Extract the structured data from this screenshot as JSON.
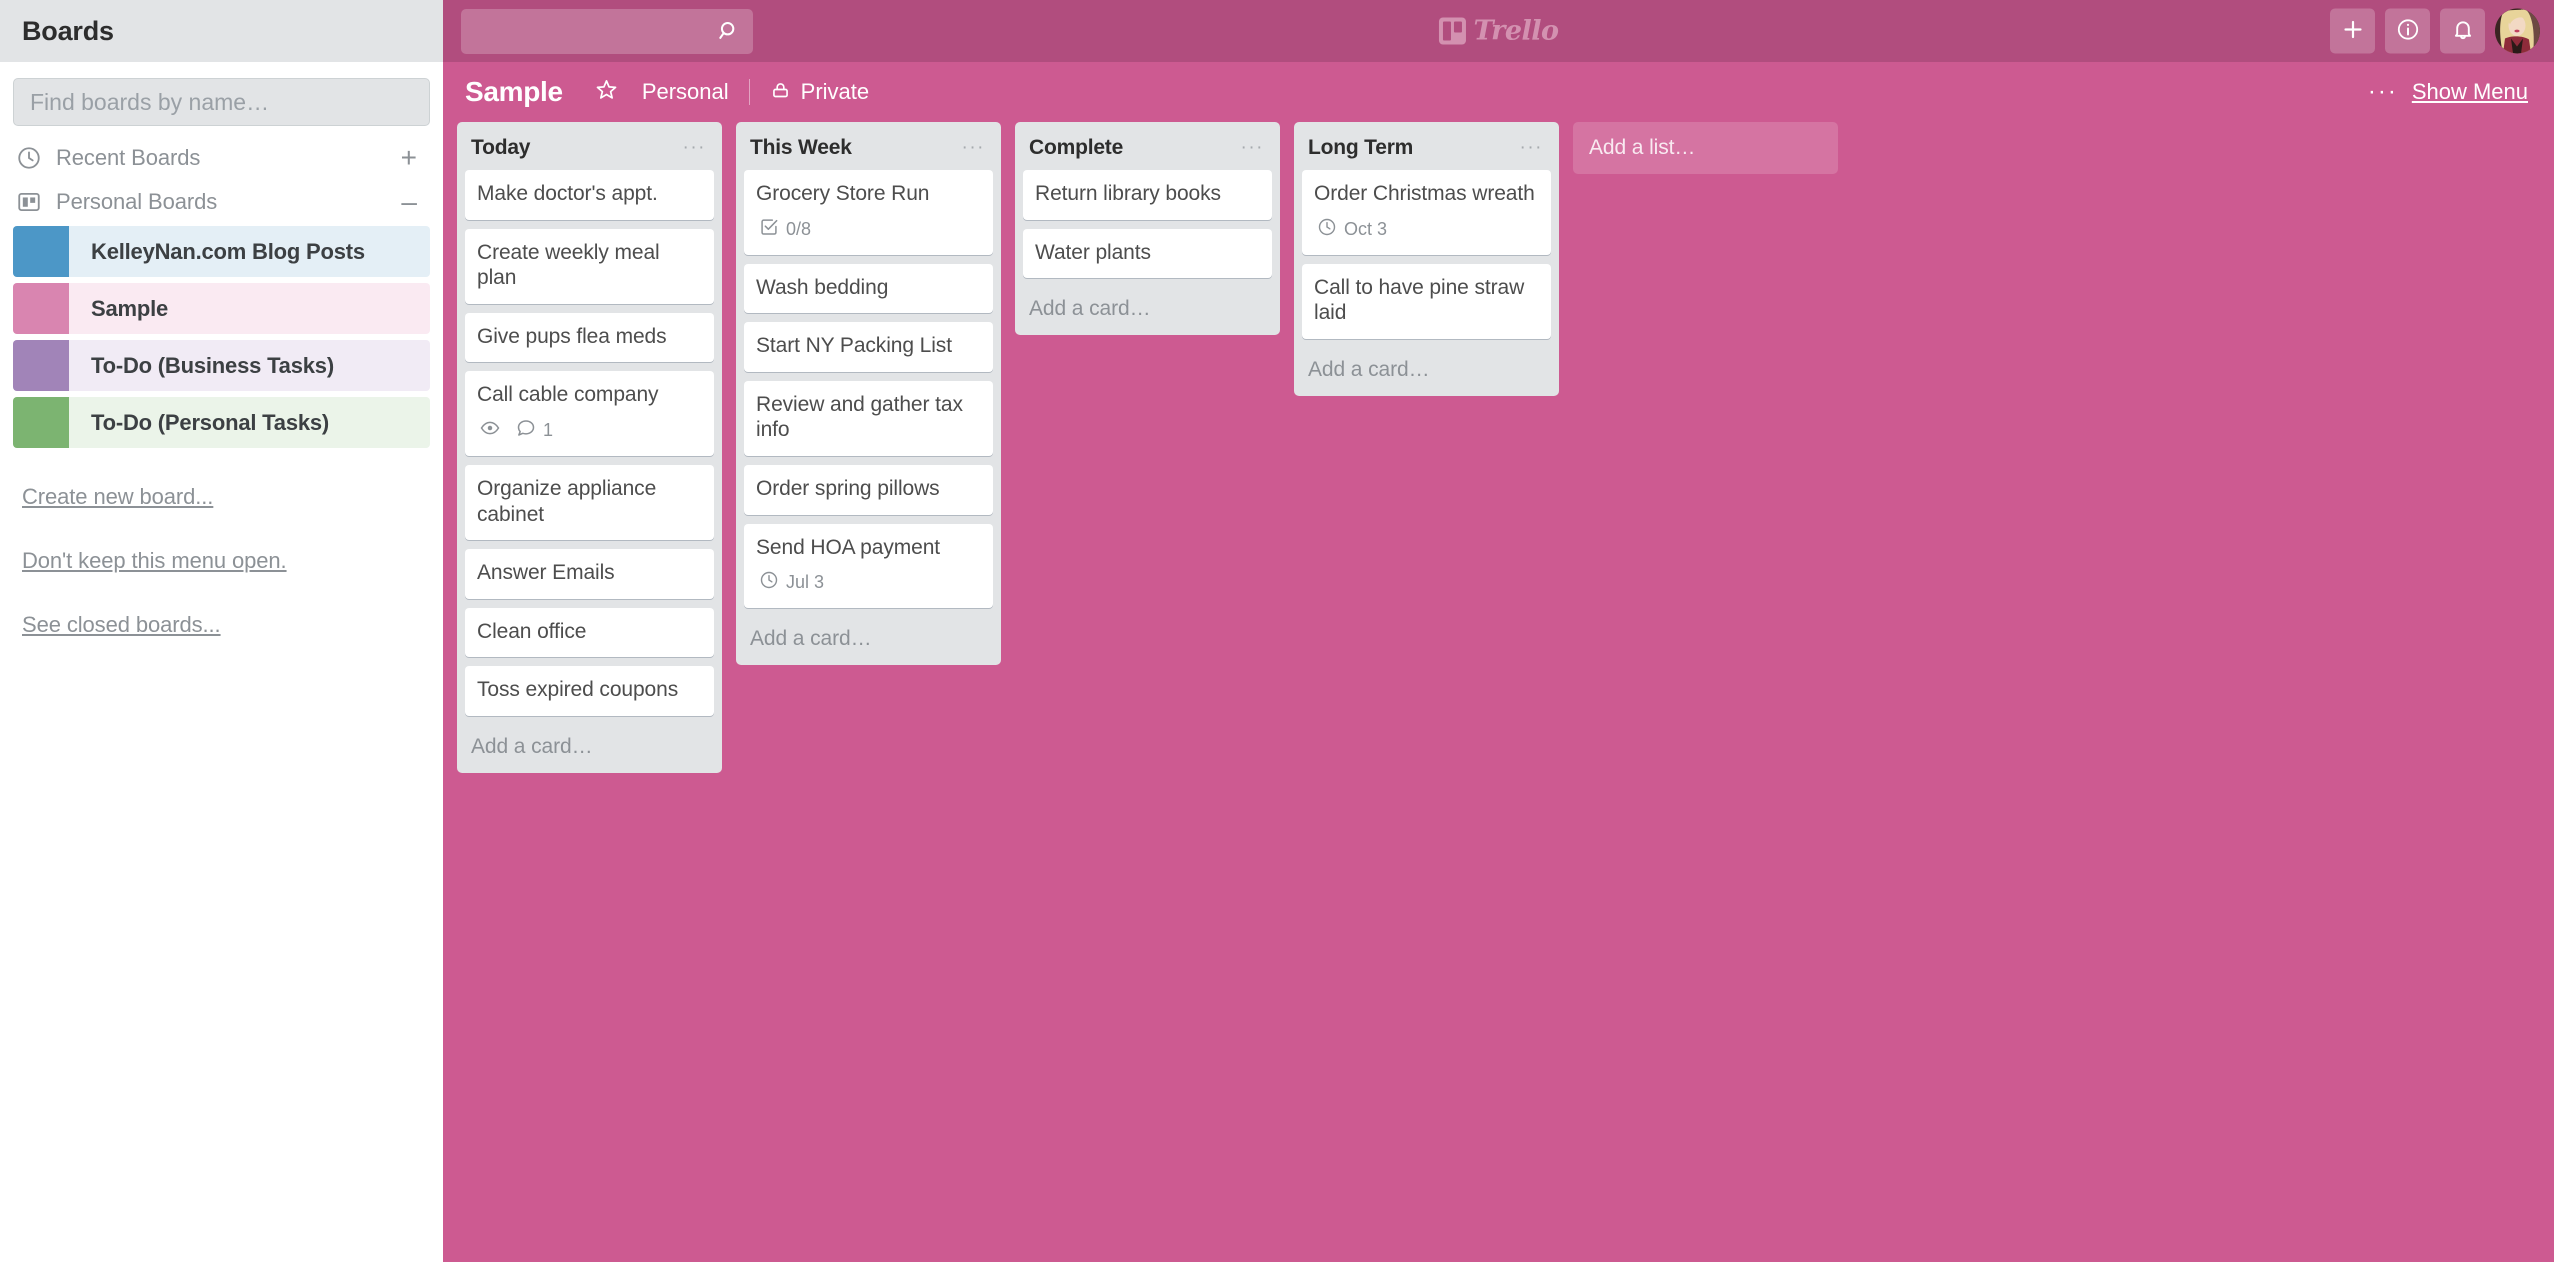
{
  "sidebar": {
    "header_title": "Boards",
    "search_placeholder": "Find boards by name…",
    "search_value": "",
    "sections": [
      {
        "label": "Recent Boards",
        "icon": "clock-icon",
        "action": "+"
      },
      {
        "label": "Personal Boards",
        "icon": "board-icon",
        "action": "–"
      }
    ],
    "boards": [
      {
        "name": "KelleyNan.com Blog Posts",
        "swatch": "#4C97C7",
        "row_bg": "#E4EFF6",
        "active": false
      },
      {
        "name": "Sample",
        "swatch": "#D985B0",
        "row_bg": "#FAEAF2",
        "active": true
      },
      {
        "name": "To-Do (Business Tasks)",
        "swatch": "#A184B8",
        "row_bg": "#F1EBF5",
        "active": false
      },
      {
        "name": "To-Do (Personal Tasks)",
        "swatch": "#7CB471",
        "row_bg": "#EBF4E9",
        "active": false
      }
    ],
    "links": [
      "Create new board...",
      "Don't keep this menu open.",
      "See closed boards..."
    ]
  },
  "topbar": {
    "search_placeholder": "",
    "search_value": "",
    "search_icon": "search-icon",
    "logo_text": "Trello",
    "buttons": [
      {
        "name": "add-button",
        "icon": "plus-icon"
      },
      {
        "name": "info-button",
        "icon": "info-icon"
      },
      {
        "name": "notifications-button",
        "icon": "bell-icon"
      }
    ],
    "avatar_label": "avatar"
  },
  "boardbar": {
    "title": "Sample",
    "star_icon": "star-icon",
    "team": "Personal",
    "visibility": "Private",
    "lock_icon": "lock-icon",
    "dots": "···",
    "show_menu": "Show Menu"
  },
  "board": {
    "add_list_label": "Add a list…",
    "add_card_label": "Add a card…",
    "list_menu_dots": "···",
    "lists": [
      {
        "title": "Today",
        "cards": [
          {
            "title": "Make doctor's appt.",
            "badges": []
          },
          {
            "title": "Create weekly meal plan",
            "badges": []
          },
          {
            "title": "Give pups flea meds",
            "badges": []
          },
          {
            "title": "Call cable company",
            "badges": [
              {
                "type": "watch",
                "icon": "eye-icon",
                "text": ""
              },
              {
                "type": "comments",
                "icon": "comment-icon",
                "text": "1"
              }
            ]
          },
          {
            "title": "Organize appliance cabinet",
            "badges": []
          },
          {
            "title": "Answer Emails",
            "badges": []
          },
          {
            "title": "Clean office",
            "badges": []
          },
          {
            "title": "Toss expired coupons",
            "badges": []
          }
        ]
      },
      {
        "title": "This Week",
        "cards": [
          {
            "title": "Grocery Store Run",
            "badges": [
              {
                "type": "checklist",
                "icon": "checklist-icon",
                "text": "0/8"
              }
            ]
          },
          {
            "title": "Wash bedding",
            "badges": []
          },
          {
            "title": "Start NY Packing List",
            "badges": []
          },
          {
            "title": "Review and gather tax info",
            "badges": []
          },
          {
            "title": "Order spring pillows",
            "badges": []
          },
          {
            "title": "Send HOA payment",
            "badges": [
              {
                "type": "due",
                "icon": "clock-icon",
                "text": "Jul 3"
              }
            ]
          }
        ]
      },
      {
        "title": "Complete",
        "cards": [
          {
            "title": "Return library books",
            "badges": []
          },
          {
            "title": "Water plants",
            "badges": []
          }
        ]
      },
      {
        "title": "Long Term",
        "cards": [
          {
            "title": "Order Christmas wreath",
            "badges": [
              {
                "type": "due",
                "icon": "clock-icon",
                "text": "Oct 3"
              }
            ]
          },
          {
            "title": "Call to have pine straw laid",
            "badges": []
          }
        ]
      }
    ]
  },
  "colors": {
    "board_background": "#CD5A91",
    "topbar": "#B14D7E",
    "list_background": "#E2E4E6",
    "card": "#FFFFFF"
  }
}
